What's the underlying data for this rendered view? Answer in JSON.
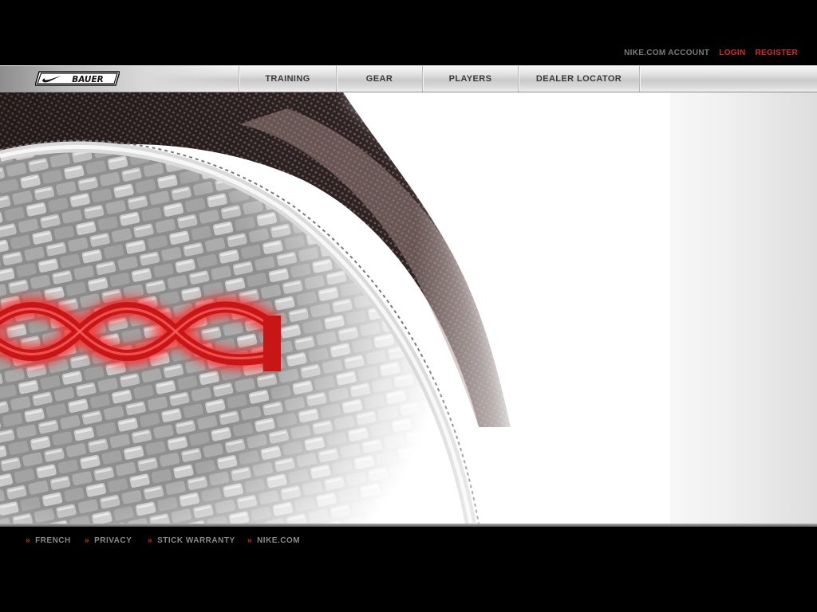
{
  "account": {
    "account_label": "NIKE.COM ACCOUNT",
    "login_label": "LOGIN",
    "register_label": "REGISTER"
  },
  "nav": {
    "tabs": [
      {
        "label": "TRAINING"
      },
      {
        "label": "GEAR"
      },
      {
        "label": "PLAYERS"
      },
      {
        "label": "DEALER LOCATOR"
      }
    ]
  },
  "logo": {
    "brand_text": "BAUER"
  },
  "footer": {
    "links": [
      {
        "label": "FRENCH"
      },
      {
        "label": "PRIVACY"
      },
      {
        "label": "STICK WARRANTY"
      },
      {
        "label": "NIKE.COM"
      }
    ]
  },
  "colors": {
    "accent_red": "#d2321f",
    "background": "#000000",
    "nav_text": "#3a3a3a",
    "footer_text": "#8a8a8a"
  }
}
